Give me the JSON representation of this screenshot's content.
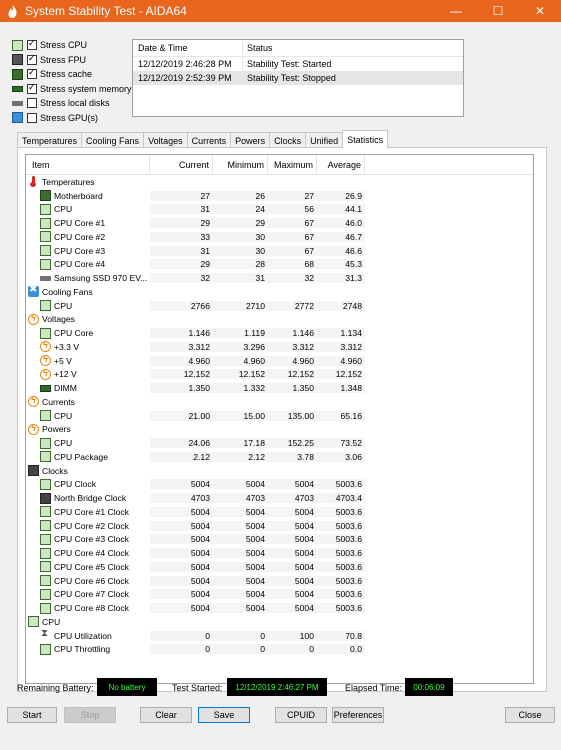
{
  "window": {
    "title": "System Stability Test - AIDA64",
    "controls": {
      "minimize": "—",
      "maximize": "☐",
      "close": "✕"
    }
  },
  "stress_options": [
    {
      "label": "Stress CPU",
      "checked": true,
      "icon": "cpu-chip-icon"
    },
    {
      "label": "Stress FPU",
      "checked": true,
      "icon": "fpu-icon"
    },
    {
      "label": "Stress cache",
      "checked": true,
      "icon": "cache-icon"
    },
    {
      "label": "Stress system memory",
      "checked": true,
      "icon": "memory-icon"
    },
    {
      "label": "Stress local disks",
      "checked": false,
      "icon": "disk-icon"
    },
    {
      "label": "Stress GPU(s)",
      "checked": false,
      "icon": "monitor-icon"
    }
  ],
  "log": {
    "headers": {
      "datetime": "Date & Time",
      "status": "Status"
    },
    "rows": [
      {
        "datetime": "12/12/2019 2:46:28 PM",
        "status": "Stability Test: Started"
      },
      {
        "datetime": "12/12/2019 2:52:39 PM",
        "status": "Stability Test: Stopped"
      }
    ]
  },
  "tabs": [
    "Temperatures",
    "Cooling Fans",
    "Voltages",
    "Currents",
    "Powers",
    "Clocks",
    "Unified",
    "Statistics"
  ],
  "active_tab": "Statistics",
  "table": {
    "headers": {
      "item": "Item",
      "current": "Current",
      "minimum": "Minimum",
      "maximum": "Maximum",
      "average": "Average"
    },
    "rows": [
      {
        "type": "group",
        "label": "Temperatures",
        "icon": "thermometer-icon"
      },
      {
        "type": "item",
        "label": "Motherboard",
        "icon": "motherboard-icon",
        "cur": "27",
        "min": "26",
        "max": "27",
        "avg": "26.9"
      },
      {
        "type": "item",
        "label": "CPU",
        "icon": "cpu-icon",
        "cur": "31",
        "min": "24",
        "max": "56",
        "avg": "44.1"
      },
      {
        "type": "item",
        "label": "CPU Core #1",
        "icon": "cpu-icon",
        "cur": "29",
        "min": "29",
        "max": "67",
        "avg": "46.0"
      },
      {
        "type": "item",
        "label": "CPU Core #2",
        "icon": "cpu-icon",
        "cur": "33",
        "min": "30",
        "max": "67",
        "avg": "46.7"
      },
      {
        "type": "item",
        "label": "CPU Core #3",
        "icon": "cpu-icon",
        "cur": "31",
        "min": "30",
        "max": "67",
        "avg": "46.6"
      },
      {
        "type": "item",
        "label": "CPU Core #4",
        "icon": "cpu-icon",
        "cur": "29",
        "min": "28",
        "max": "68",
        "avg": "45.3"
      },
      {
        "type": "item",
        "label": "Samsung SSD 970 EV...",
        "icon": "ssd-icon",
        "cur": "32",
        "min": "31",
        "max": "32",
        "avg": "31.3"
      },
      {
        "type": "group",
        "label": "Cooling Fans",
        "icon": "fan-icon"
      },
      {
        "type": "item",
        "label": "CPU",
        "icon": "cpu-icon",
        "cur": "2766",
        "min": "2710",
        "max": "2772",
        "avg": "2748"
      },
      {
        "type": "group",
        "label": "Voltages",
        "icon": "voltage-icon"
      },
      {
        "type": "item",
        "label": "CPU Core",
        "icon": "cpu-icon",
        "cur": "1.146",
        "min": "1.119",
        "max": "1.146",
        "avg": "1.134"
      },
      {
        "type": "item",
        "label": "+3.3 V",
        "icon": "voltage-icon",
        "cur": "3.312",
        "min": "3.296",
        "max": "3.312",
        "avg": "3.312"
      },
      {
        "type": "item",
        "label": "+5 V",
        "icon": "voltage-icon",
        "cur": "4.960",
        "min": "4.960",
        "max": "4.960",
        "avg": "4.960"
      },
      {
        "type": "item",
        "label": "+12 V",
        "icon": "voltage-icon",
        "cur": "12.152",
        "min": "12.152",
        "max": "12.152",
        "avg": "12.152"
      },
      {
        "type": "item",
        "label": "DIMM",
        "icon": "dimm-icon",
        "cur": "1.350",
        "min": "1.332",
        "max": "1.350",
        "avg": "1.348"
      },
      {
        "type": "group",
        "label": "Currents",
        "icon": "current-icon"
      },
      {
        "type": "item",
        "label": "CPU",
        "icon": "cpu-icon",
        "cur": "21.00",
        "min": "15.00",
        "max": "135.00",
        "avg": "65.16"
      },
      {
        "type": "group",
        "label": "Powers",
        "icon": "power-icon"
      },
      {
        "type": "item",
        "label": "CPU",
        "icon": "cpu-icon",
        "cur": "24.06",
        "min": "17.18",
        "max": "152.25",
        "avg": "73.52"
      },
      {
        "type": "item",
        "label": "CPU Package",
        "icon": "cpu-icon",
        "cur": "2.12",
        "min": "2.12",
        "max": "3.78",
        "avg": "3.06"
      },
      {
        "type": "group",
        "label": "Clocks",
        "icon": "clock-chip-icon"
      },
      {
        "type": "item",
        "label": "CPU Clock",
        "icon": "cpu-icon",
        "cur": "5004",
        "min": "5004",
        "max": "5004",
        "avg": "5003.6"
      },
      {
        "type": "item",
        "label": "North Bridge Clock",
        "icon": "northbridge-icon",
        "cur": "4703",
        "min": "4703",
        "max": "4703",
        "avg": "4703.4"
      },
      {
        "type": "item",
        "label": "CPU Core #1 Clock",
        "icon": "cpu-icon",
        "cur": "5004",
        "min": "5004",
        "max": "5004",
        "avg": "5003.6"
      },
      {
        "type": "item",
        "label": "CPU Core #2 Clock",
        "icon": "cpu-icon",
        "cur": "5004",
        "min": "5004",
        "max": "5004",
        "avg": "5003.6"
      },
      {
        "type": "item",
        "label": "CPU Core #3 Clock",
        "icon": "cpu-icon",
        "cur": "5004",
        "min": "5004",
        "max": "5004",
        "avg": "5003.6"
      },
      {
        "type": "item",
        "label": "CPU Core #4 Clock",
        "icon": "cpu-icon",
        "cur": "5004",
        "min": "5004",
        "max": "5004",
        "avg": "5003.6"
      },
      {
        "type": "item",
        "label": "CPU Core #5 Clock",
        "icon": "cpu-icon",
        "cur": "5004",
        "min": "5004",
        "max": "5004",
        "avg": "5003.6"
      },
      {
        "type": "item",
        "label": "CPU Core #6 Clock",
        "icon": "cpu-icon",
        "cur": "5004",
        "min": "5004",
        "max": "5004",
        "avg": "5003.6"
      },
      {
        "type": "item",
        "label": "CPU Core #7 Clock",
        "icon": "cpu-icon",
        "cur": "5004",
        "min": "5004",
        "max": "5004",
        "avg": "5003.6"
      },
      {
        "type": "item",
        "label": "CPU Core #8 Clock",
        "icon": "cpu-icon",
        "cur": "5004",
        "min": "5004",
        "max": "5004",
        "avg": "5003.6"
      },
      {
        "type": "group",
        "label": "CPU",
        "icon": "cpu-icon"
      },
      {
        "type": "item",
        "label": "CPU Utilization",
        "icon": "hourglass-icon",
        "cur": "0",
        "min": "0",
        "max": "100",
        "avg": "70.8"
      },
      {
        "type": "item",
        "label": "CPU Throttling",
        "icon": "cpu-icon",
        "cur": "0",
        "min": "0",
        "max": "0",
        "avg": "0.0"
      }
    ]
  },
  "status_bar": {
    "battery_label": "Remaining Battery:",
    "battery_value": "No battery",
    "started_label": "Test Started:",
    "started_value": "12/12/2019 2:46:27 PM",
    "elapsed_label": "Elapsed Time:",
    "elapsed_value": "00:06:09"
  },
  "buttons": {
    "start": "Start",
    "stop": "Stop",
    "clear": "Clear",
    "save": "Save",
    "cpuid": "CPUID",
    "preferences": "Preferences",
    "close": "Close"
  },
  "colors": {
    "titlebar": "#e8651d",
    "led_text": "#33ff33",
    "led_bg": "#000000"
  }
}
